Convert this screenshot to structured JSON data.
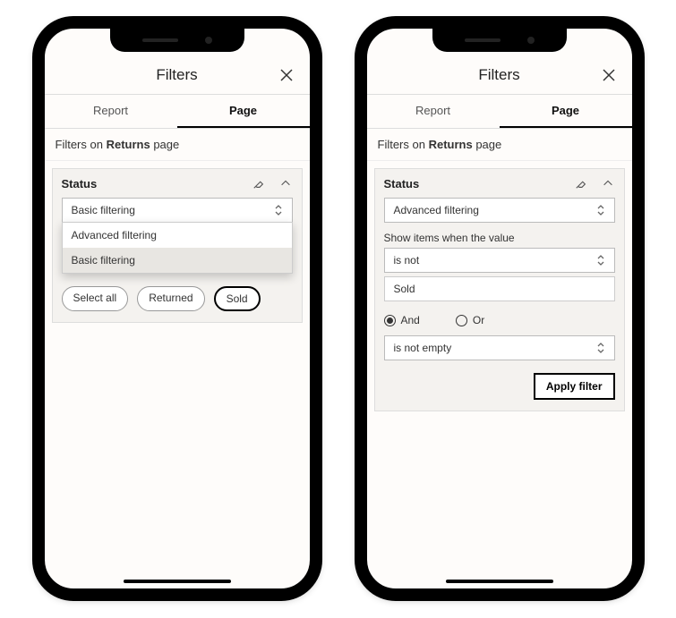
{
  "header": {
    "title": "Filters"
  },
  "tabs": {
    "report": "Report",
    "page": "Page",
    "active": "page"
  },
  "subhead": {
    "prefix": "Filters on ",
    "bold": "Returns",
    "suffix": " page"
  },
  "card": {
    "title": "Status",
    "eraser_icon": "eraser-icon",
    "chevron_icon": "chevron-up-icon"
  },
  "phone1": {
    "select_value": "Basic filtering",
    "dropdown_options": [
      "Advanced filtering",
      "Basic filtering"
    ],
    "dropdown_selected": "Basic filtering",
    "chips": [
      {
        "label": "Select all",
        "active": false
      },
      {
        "label": "Returned",
        "active": false
      },
      {
        "label": "Sold",
        "active": true
      }
    ]
  },
  "phone2": {
    "select_value": "Advanced filtering",
    "show_label": "Show items when the value",
    "condition1": "is not",
    "value1": "Sold",
    "logic": {
      "and": "And",
      "or": "Or",
      "selected": "and"
    },
    "condition2": "is not empty",
    "apply_label": "Apply filter"
  }
}
